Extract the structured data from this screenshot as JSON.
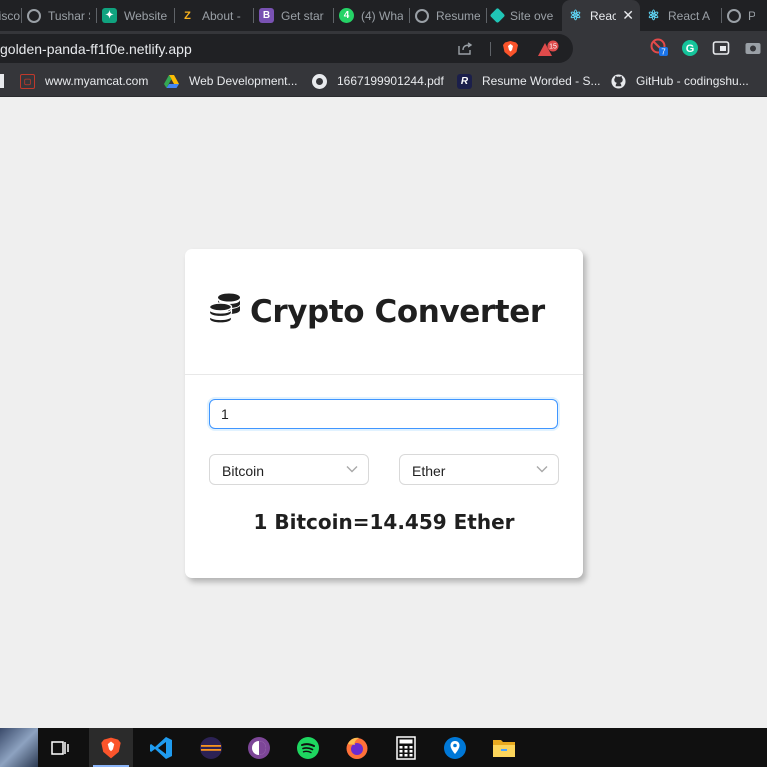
{
  "browser": {
    "tabs": [
      {
        "label": "Disco",
        "icon": "discord-icon",
        "color": "#5865f2"
      },
      {
        "label": "Tushar S",
        "icon": "globe-icon",
        "color": "#9aa0a6"
      },
      {
        "label": "Website",
        "icon": "chatgpt-icon",
        "color": "#10a37f"
      },
      {
        "label": "About -",
        "icon": "zoho-icon",
        "color": "#e42527"
      },
      {
        "label": "Get star",
        "icon": "bootstrap-icon",
        "color": "#7952b3"
      },
      {
        "label": "(4) Wha",
        "icon": "whatsapp-icon",
        "color": "#25d366"
      },
      {
        "label": "Resume",
        "icon": "globe-icon",
        "color": "#9aa0a6"
      },
      {
        "label": "Site ove",
        "icon": "netlify-icon",
        "color": "#20c6b7"
      },
      {
        "label": "Reac",
        "icon": "react-icon",
        "color": "#61dafb",
        "active": true
      },
      {
        "label": "React A",
        "icon": "react-icon",
        "color": "#61dafb"
      },
      {
        "label": "Pra",
        "icon": "globe-icon",
        "color": "#9aa0a6"
      }
    ],
    "url": "golden-panda-ff1f0e.netlify.app",
    "rewards_badge": "15",
    "extension_badge": "7",
    "bookmarks": [
      {
        "label": "",
        "icon": "apps-icon"
      },
      {
        "label": "www.myamcat.com",
        "icon": "myamcat-icon"
      },
      {
        "label": "Web Development...",
        "icon": "google-drive-icon"
      },
      {
        "label": "1667199901244.pdf",
        "icon": "globe-icon"
      },
      {
        "label": "Resume Worded - S...",
        "icon": "resume-worded-icon"
      },
      {
        "label": "GitHub - codingshu...",
        "icon": "github-icon"
      }
    ]
  },
  "app": {
    "title": "Crypto Converter",
    "amount_value": "1",
    "from_currency": "Bitcoin",
    "to_currency": "Ether",
    "result": {
      "left": "1 Bitcoin",
      "equals": "=",
      "right": "14.459 Ether"
    }
  },
  "taskbar": {
    "items": [
      {
        "icon": "task-view-icon"
      },
      {
        "icon": "brave-icon",
        "active": true
      },
      {
        "icon": "vscode-icon"
      },
      {
        "icon": "eclipse-icon"
      },
      {
        "icon": "tor-icon"
      },
      {
        "icon": "spotify-icon"
      },
      {
        "icon": "firefox-icon"
      },
      {
        "icon": "calculator-icon"
      },
      {
        "icon": "maps-icon"
      },
      {
        "icon": "file-explorer-icon"
      }
    ]
  },
  "colors": {
    "page_background": "#efefef",
    "input_focus_border": "#4096ff",
    "browser_dark": "#202124"
  }
}
